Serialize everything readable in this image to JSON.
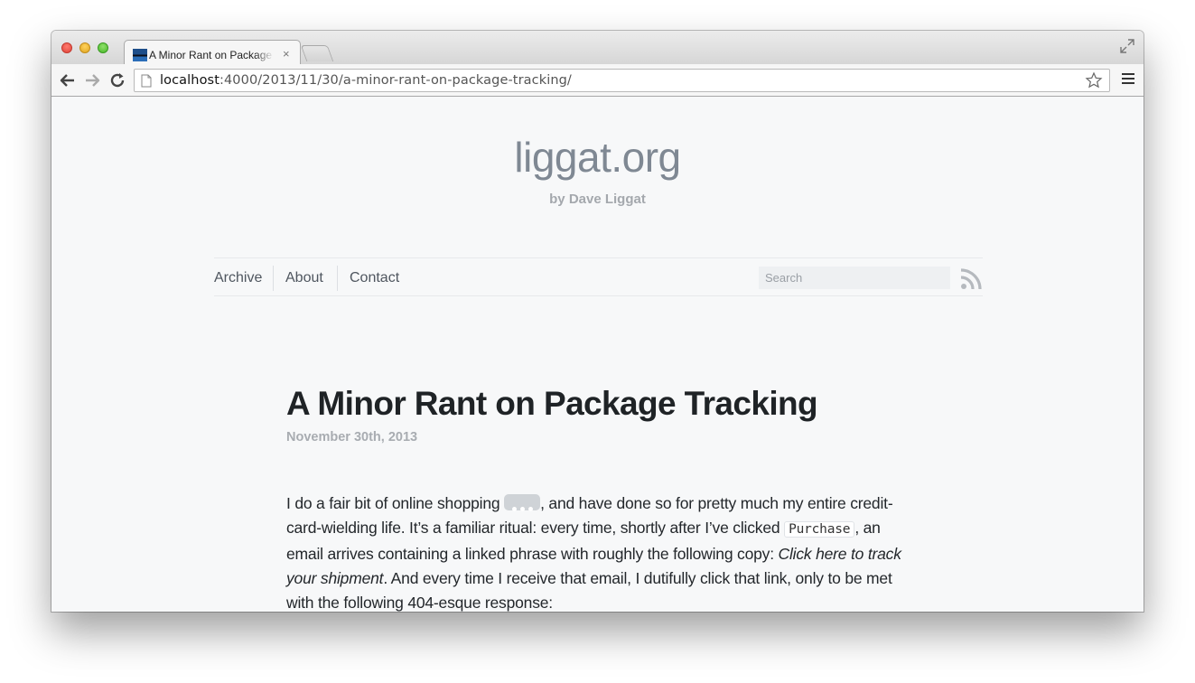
{
  "browser": {
    "tab_title": "A Minor Rant on Package Tracking",
    "tab_close": "×",
    "url_host": "localhost",
    "url_rest": ":4000/2013/11/30/a-minor-rant-on-package-tracking/"
  },
  "site": {
    "title": "liggat.org",
    "subtitle": "by Dave Liggat"
  },
  "nav": {
    "items": [
      {
        "label": "Archive"
      },
      {
        "label": "About"
      },
      {
        "label": "Contact"
      }
    ],
    "search_placeholder": "Search"
  },
  "post": {
    "title": "A Minor Rant on Package Tracking",
    "date": "November 30th, 2013",
    "body": {
      "p1_a": "I do a fair bit of online shopping ",
      "p1_b": ", and have done so for pretty much my entire credit-card-wielding life. It’s a familiar ritual: every time, shortly after I’ve clicked ",
      "code": "Purchase",
      "p1_c": ", an email arrives containing a linked phrase with roughly the following copy: ",
      "emphasis": "Click here to track your shipment",
      "p1_d": ". And every time I receive that email, I dutifully click that link, only to be met with the following 404-esque response:"
    }
  },
  "icons": {
    "back": "back-arrow-icon",
    "forward": "forward-arrow-icon",
    "reload": "reload-icon",
    "star": "star-icon",
    "menu": "hamburger-menu-icon",
    "rss": "rss-icon"
  }
}
